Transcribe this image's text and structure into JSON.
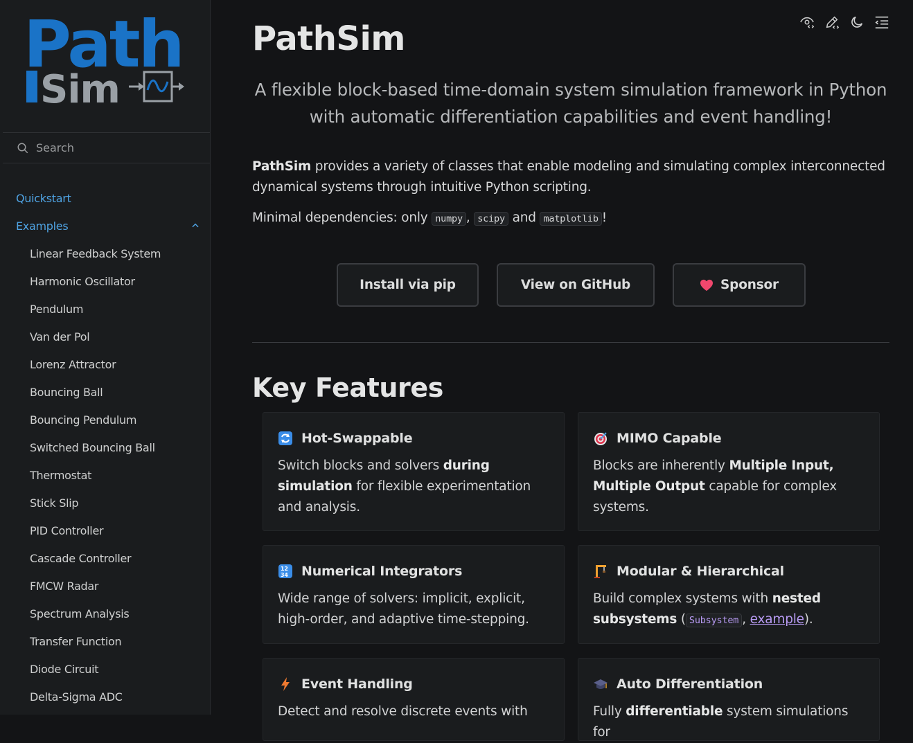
{
  "logo": {
    "line1": "Path",
    "line2": "Sim",
    "primary_color": "#1a73c7",
    "secondary_color": "#9aa0a6"
  },
  "search": {
    "placeholder": "Search"
  },
  "nav": {
    "quickstart": "Quickstart",
    "examples": "Examples",
    "items": [
      "Linear Feedback System",
      "Harmonic Oscillator",
      "Pendulum",
      "Van der Pol",
      "Lorenz Attractor",
      "Bouncing Ball",
      "Bouncing Pendulum",
      "Switched Bouncing Ball",
      "Thermostat",
      "Stick Slip",
      "PID Controller",
      "Cascade Controller",
      "FMCW Radar",
      "Spectrum Analysis",
      "Transfer Function",
      "Diode Circuit",
      "Delta-Sigma ADC"
    ]
  },
  "toolbar": {
    "icons": [
      "view-source-icon",
      "edit-icon",
      "dark-mode-icon",
      "toc-icon"
    ]
  },
  "main": {
    "title": "PathSim",
    "tagline": "A flexible block-based time-domain system simulation framework in Python with automatic differentiation capabilities and event handling!",
    "intro_strong": "PathSim",
    "intro_rest": " provides a variety of classes that enable modeling and simulating complex interconnected dynamical systems through intuitive Python scripting.",
    "deps_prefix": "Minimal dependencies: only ",
    "dep1": "numpy",
    "dep2": "scipy",
    "dep3": "matplotlib",
    "sep1": ", ",
    "and": " and ",
    "suffix": "!",
    "buttons": {
      "pip": "Install via pip",
      "github": "View on GitHub",
      "sponsor": "Sponsor"
    },
    "features_heading": "Key Features"
  },
  "features": {
    "hot": {
      "title": "Hot-Swappable",
      "t1": "Switch blocks and solvers ",
      "b1": "during simulation",
      "t2": " for flexible experimentation and analysis."
    },
    "mimo": {
      "title": "MIMO Capable",
      "t1": "Blocks are inherently ",
      "b1": "Multiple Input, Multiple Output",
      "t2": " capable for complex systems."
    },
    "integrators": {
      "title": "Numerical Integrators",
      "t1": "Wide range of solvers: implicit, explicit, high-order, and adaptive time-stepping."
    },
    "modular": {
      "title": "Modular & Hierarchical",
      "t1": "Build complex systems with ",
      "b1": "nested subsystems",
      "t2": " (",
      "code": "Subsystem",
      "t3": ", ",
      "link": "example",
      "t4": ")."
    },
    "events": {
      "title": "Event Handling",
      "t1": "Detect and resolve discrete events with"
    },
    "autodiff": {
      "title": "Auto Differentiation",
      "t1": "Fully ",
      "b1": "differentiable",
      "t2": " system simulations for"
    }
  }
}
